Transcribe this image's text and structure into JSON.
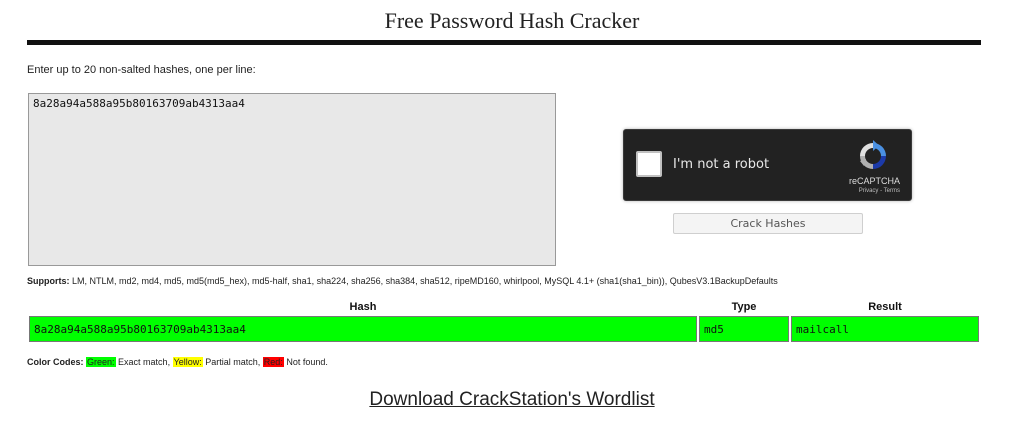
{
  "page": {
    "title": "Free Password Hash Cracker",
    "instructions": "Enter up to 20 non-salted hashes, one per line:",
    "hash_input_value": "8a28a94a588a95b80163709ab4313aa4"
  },
  "recaptcha": {
    "label": "I'm not a robot",
    "brand": "reCAPTCHA",
    "links": "Privacy - Terms"
  },
  "crack_button": "Crack Hashes",
  "supports": {
    "label": "Supports:",
    "text": " LM, NTLM, md2, md4, md5, md5(md5_hex), md5-half, sha1, sha224, sha256, sha384, sha512, ripeMD160, whirlpool, MySQL 4.1+ (sha1(sha1_bin)), QubesV3.1BackupDefaults"
  },
  "results": {
    "headers": [
      "Hash",
      "Type",
      "Result"
    ],
    "rows": [
      {
        "hash": "8a28a94a588a95b80163709ab4313aa4",
        "type": "md5",
        "result": "mailcall",
        "status_color": "#00ff00"
      }
    ]
  },
  "color_codes": {
    "label": "Color Codes:",
    "green": "Green:",
    "green_desc": " Exact match, ",
    "yellow": "Yellow:",
    "yellow_desc": " Partial match, ",
    "red": "Red:",
    "red_desc": " Not found.",
    "colors": {
      "green": "#00ff00",
      "yellow": "#ffff00",
      "red": "#ff0000"
    }
  },
  "download_link": "Download CrackStation's Wordlist"
}
